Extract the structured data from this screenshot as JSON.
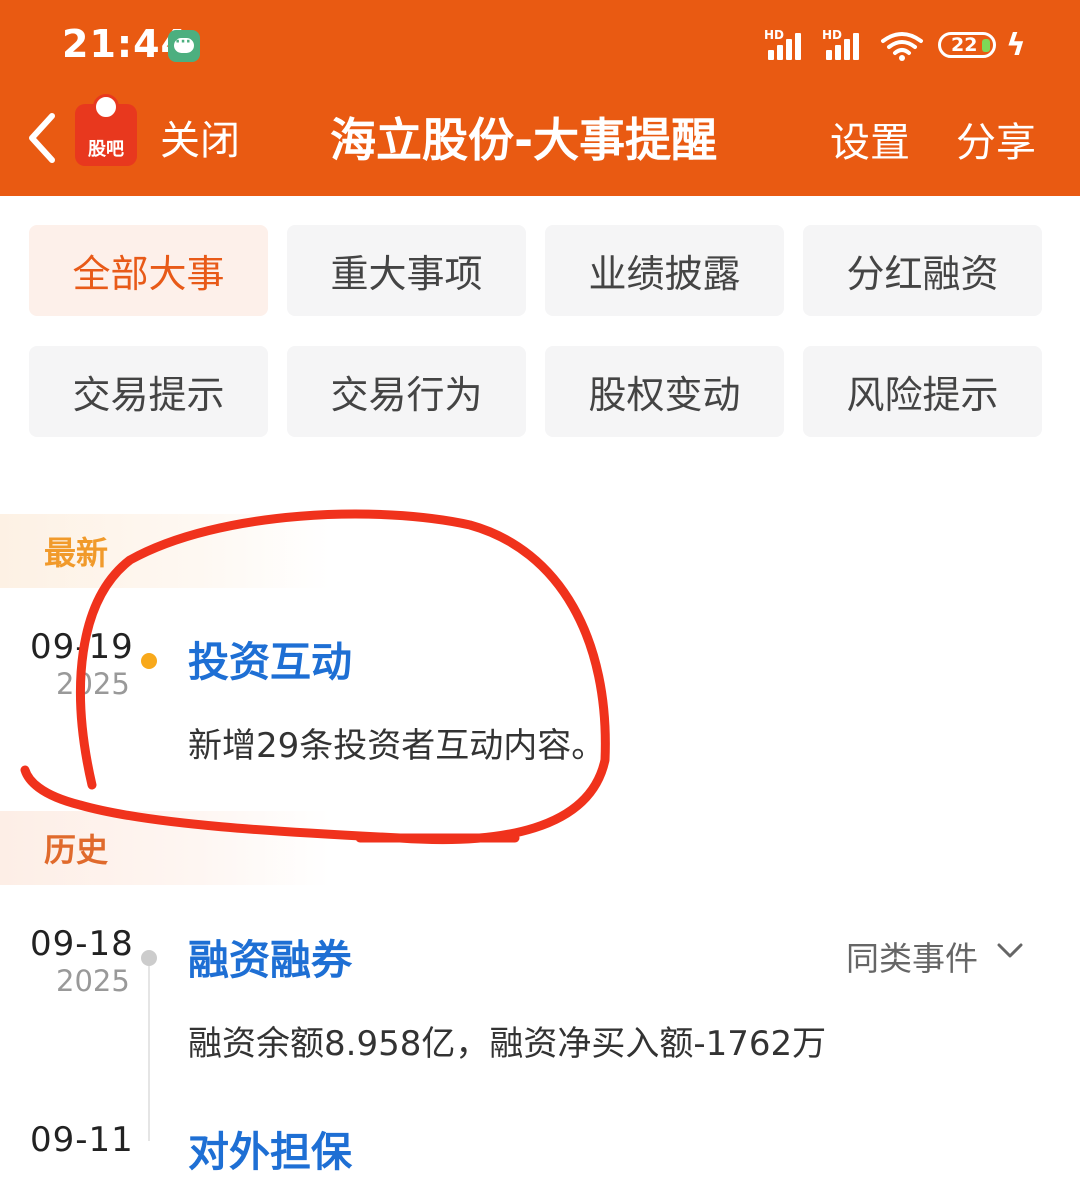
{
  "status_bar": {
    "time": "21:44",
    "signal_1": "HD",
    "signal_2": "HD",
    "battery": "22",
    "icons": [
      "chat-bubble-icon",
      "signal-icon",
      "wifi-icon",
      "battery-icon",
      "charging-icon"
    ]
  },
  "header": {
    "app_logo_text": "股吧",
    "close": "关闭",
    "title": "海立股份-大事提醒",
    "settings": "设置",
    "share": "分享",
    "color": "#e95a12"
  },
  "filters": [
    {
      "label": "全部大事",
      "active": true
    },
    {
      "label": "重大事项",
      "active": false
    },
    {
      "label": "业绩披露",
      "active": false
    },
    {
      "label": "分红融资",
      "active": false
    },
    {
      "label": "交易提示",
      "active": false
    },
    {
      "label": "交易行为",
      "active": false
    },
    {
      "label": "股权变动",
      "active": false
    },
    {
      "label": "风险提示",
      "active": false
    }
  ],
  "sections": {
    "latest": "最新",
    "history": "历史"
  },
  "events": [
    {
      "date": "09-19",
      "year": "2025",
      "title": "投资互动",
      "desc": "新增29条投资者互动内容。"
    },
    {
      "date": "09-18",
      "year": "2025",
      "title": "融资融券",
      "desc": "融资余额8.958亿，融资净买入额-1762万",
      "similar": "同类事件"
    },
    {
      "date": "09-11",
      "title": "对外担保"
    }
  ],
  "colors": {
    "accent": "#e95a12",
    "link_blue": "#1e6fd4",
    "latest_dot": "#f8a91b",
    "annotation_red": "#f0321c"
  }
}
